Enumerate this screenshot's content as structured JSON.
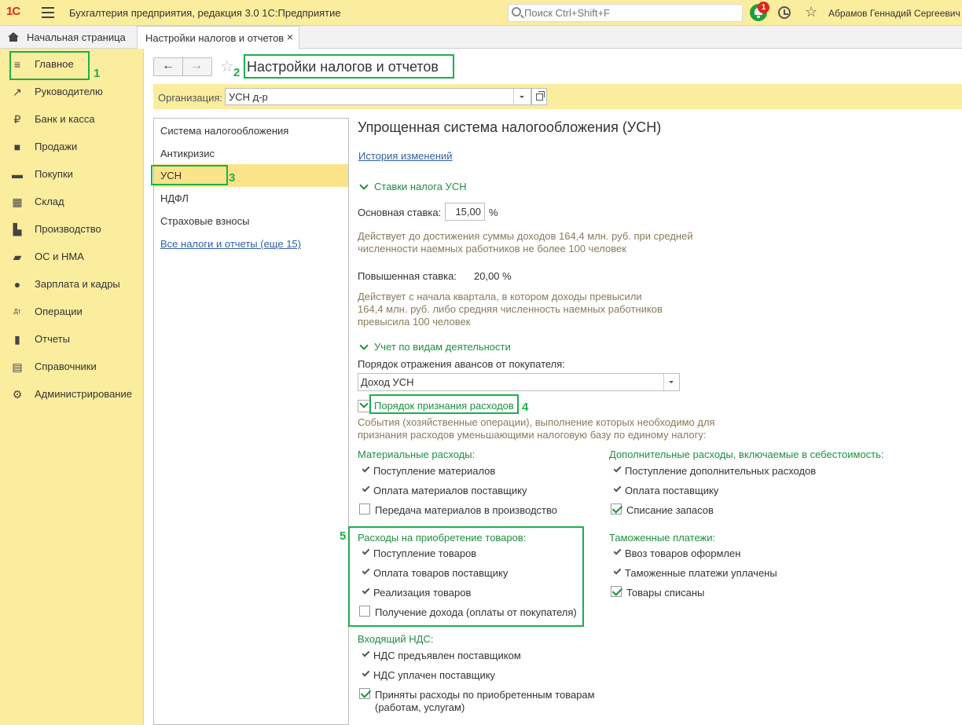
{
  "app": {
    "title": "Бухгалтерия предприятия, редакция 3.0 1С:Предприятие",
    "logo": "1С",
    "search_placeholder": "Поиск Ctrl+Shift+F",
    "notifications_count": "1",
    "user": "Абрамов Геннадий Сергеевич"
  },
  "tabs": {
    "home": "Начальная страница",
    "active": "Настройки налогов и отчетов",
    "close": "×"
  },
  "sidebar": {
    "items": [
      {
        "label": "Главное",
        "icon": "menu-icon"
      },
      {
        "label": "Руководителю",
        "icon": "trend-icon"
      },
      {
        "label": "Банк и касса",
        "icon": "ruble-icon"
      },
      {
        "label": "Продажи",
        "icon": "bag-icon"
      },
      {
        "label": "Покупки",
        "icon": "cart-icon"
      },
      {
        "label": "Склад",
        "icon": "grid-icon"
      },
      {
        "label": "Производство",
        "icon": "factory-icon"
      },
      {
        "label": "ОС и НМА",
        "icon": "truck-icon"
      },
      {
        "label": "Зарплата и кадры",
        "icon": "person-icon"
      },
      {
        "label": "Операции",
        "icon": "dtkt-icon"
      },
      {
        "label": "Отчеты",
        "icon": "chart-icon"
      },
      {
        "label": "Справочники",
        "icon": "book-icon"
      },
      {
        "label": "Администрирование",
        "icon": "gear-icon"
      }
    ]
  },
  "header": {
    "title": "Настройки налогов и отчетов",
    "org_label": "Организация:",
    "org_value": "УСН д-р"
  },
  "sections": {
    "items": [
      "Система налогообложения",
      "Антикризис",
      "УСН",
      "НДФЛ",
      "Страховые взносы"
    ],
    "all_link": "Все налоги и отчеты (еще 15)"
  },
  "annotations": [
    "1",
    "2",
    "3",
    "4",
    "5"
  ],
  "main": {
    "title": "Упрощенная система налогообложения (УСН)",
    "history_link": "История изменений",
    "rates_group": "Ставки налога УСН",
    "base_rate_label": "Основная ставка:",
    "base_rate_value": "15,00",
    "percent": "%",
    "base_rate_note": "Действует до достижения суммы доходов 164,4 млн. руб. при средней численности наемных работников не более 100 человек",
    "high_rate_label": "Повышенная ставка:",
    "high_rate_value": "20,00 %",
    "high_rate_note": "Действует с начала квартала, в котором доходы превысили 164,4 млн. руб. либо средняя численность наемных работников превысила 100 человек",
    "activity_group": "Учет по видам деятельности",
    "advances_label": "Порядок отражения авансов от покупателя:",
    "advances_value": "Доход УСН",
    "expenses_group": "Порядок признания расходов",
    "expenses_note": "События (хозяйственные операции), выполнение которых необходимо для признания расходов уменьшающими налоговую базу по единому налогу:",
    "material": {
      "title": "Материальные расходы:",
      "items": [
        "Поступление материалов",
        "Оплата материалов поставщику",
        "Передача материалов в производство"
      ]
    },
    "additional": {
      "title": "Дополнительные расходы, включаемые в себестоимость:",
      "items": [
        "Поступление дополнительных расходов",
        "Оплата поставщику",
        "Списание запасов"
      ]
    },
    "goods": {
      "title": "Расходы на приобретение товаров:",
      "items": [
        "Поступление товаров",
        "Оплата товаров поставщику",
        "Реализация товаров",
        "Получение дохода (оплаты от покупателя)"
      ]
    },
    "customs": {
      "title": "Таможенные платежи:",
      "items": [
        "Ввоз товаров оформлен",
        "Таможенные платежи уплачены",
        "Товары списаны"
      ]
    },
    "vat": {
      "title": "Входящий НДС:",
      "items": [
        "НДС предъявлен поставщиком",
        "НДС уплачен поставщику",
        "Приняты расходы по приобретенным товарам (работам, услугам)"
      ]
    }
  }
}
